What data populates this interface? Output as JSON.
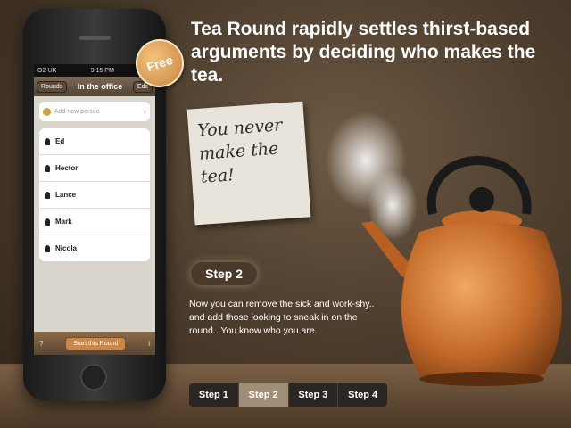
{
  "headline": "Tea Round rapidly settles thirst-based arguments by deciding who makes the tea.",
  "badge": "Free",
  "note": {
    "line1": "You never",
    "line2": "make the",
    "line3": "tea!"
  },
  "phone": {
    "status": {
      "carrier": "O2-UK",
      "time": "9:15 PM"
    },
    "nav": {
      "left": "Rounds",
      "title": "In the office",
      "right": "Edit"
    },
    "add_placeholder": "Add new person",
    "people": [
      "Ed",
      "Hector",
      "Lance",
      "Mark",
      "Nicola"
    ],
    "toolbar": {
      "help": "?",
      "start": "Start this Round",
      "info": "i"
    }
  },
  "step_badge": "Step 2",
  "description": "Now you can remove the sick and work-shy.. and add those looking to sneak in on the round.. You know who you are.",
  "steps": [
    "Step 1",
    "Step 2",
    "Step 3",
    "Step 4"
  ],
  "active_step": 1,
  "colors": {
    "accent": "#c9884a",
    "background": "#4e3e2e"
  }
}
